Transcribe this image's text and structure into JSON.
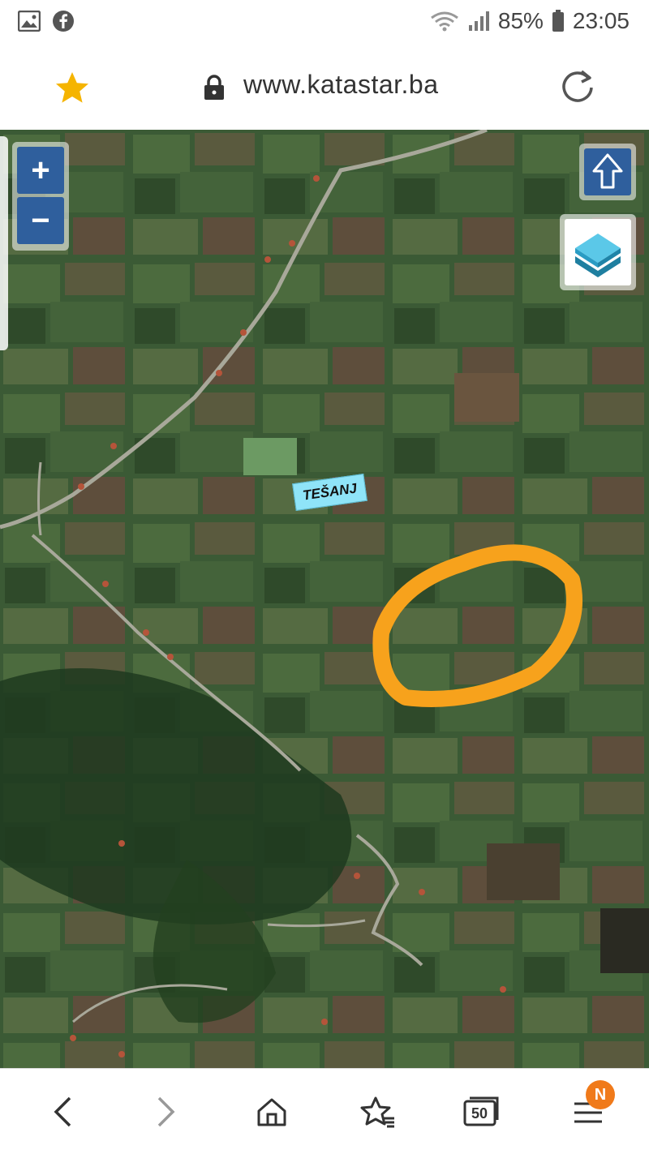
{
  "status_bar": {
    "battery_percent": "85%",
    "time": "23:05",
    "left_icons": [
      "image-icon",
      "facebook-icon"
    ],
    "right_icons": [
      "wifi-icon",
      "signal-icon",
      "battery-icon"
    ]
  },
  "browser": {
    "url": "www.katastar.ba",
    "accent_star": "#f5b400"
  },
  "map": {
    "zoom_in_label": "+",
    "zoom_out_label": "−",
    "place_label": "TEŠANJ",
    "highlight_color": "#f7a21c"
  },
  "bottom_nav": {
    "tabs_count": "50",
    "menu_badge": "N",
    "items": [
      "back",
      "forward",
      "home",
      "bookmarks",
      "tabs",
      "menu"
    ]
  }
}
